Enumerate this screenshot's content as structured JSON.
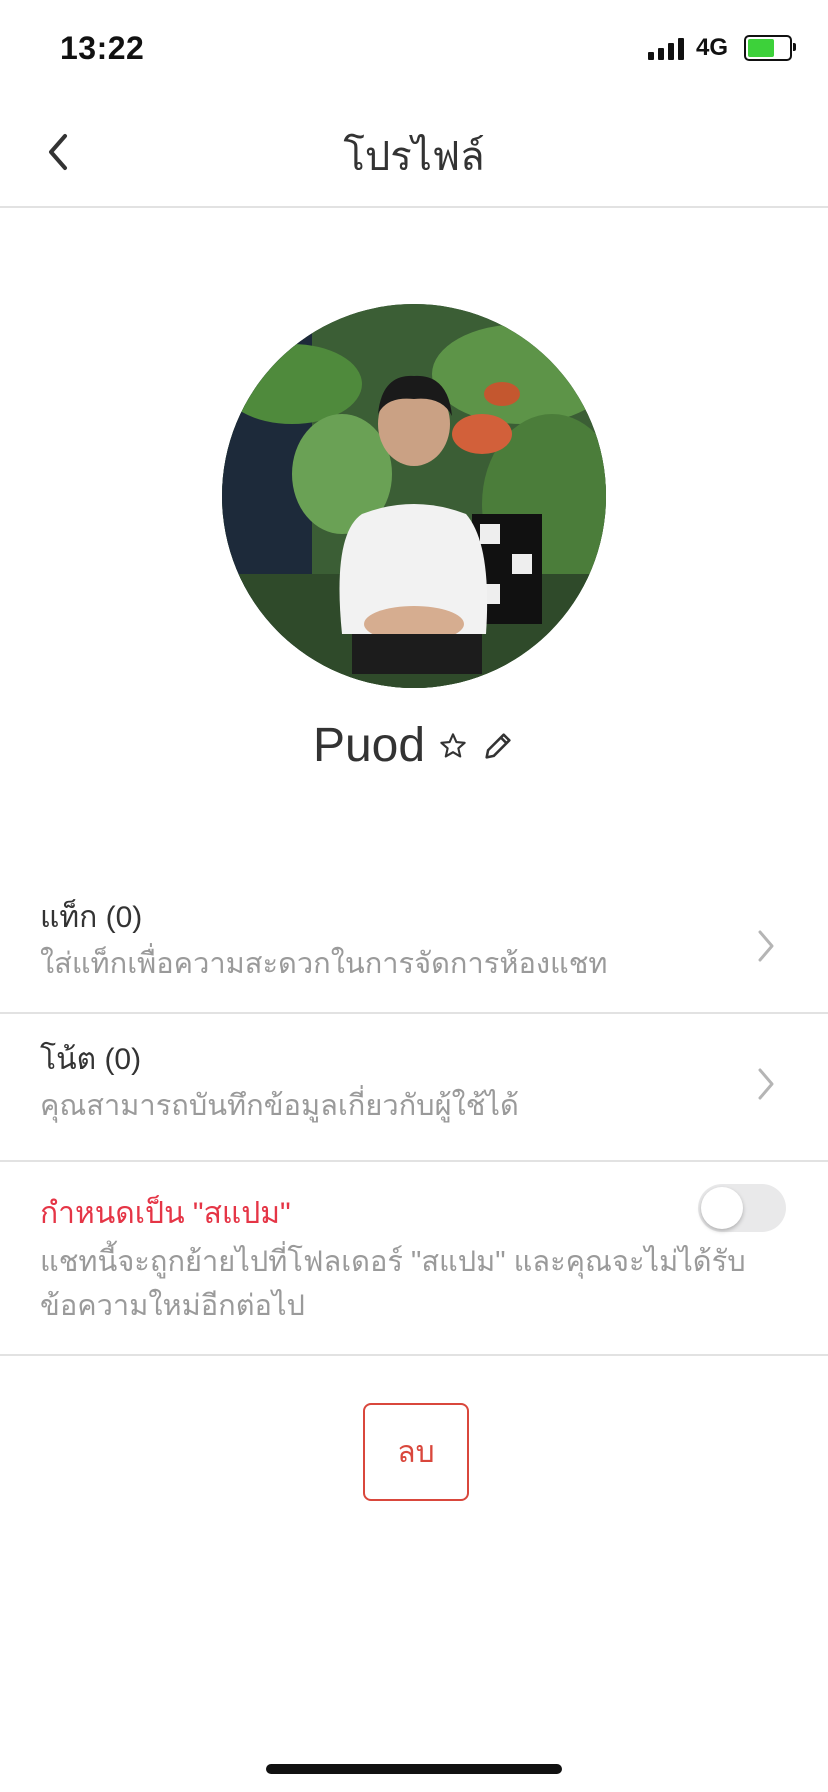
{
  "status_bar": {
    "time": "13:22",
    "network": "4G"
  },
  "header": {
    "title": "โปรไฟล์"
  },
  "profile": {
    "name": "Puod"
  },
  "rows": {
    "tag": {
      "title": "แท็ก (0)",
      "subtitle": "ใส่แท็กเพื่อความสะดวกในการจัดการห้องแชท"
    },
    "note": {
      "title": "โน้ต (0)",
      "subtitle": "คุณสามารถบันทึกข้อมูลเกี่ยวกับผู้ใช้ได้"
    },
    "spam": {
      "title": "กำหนดเป็น \"สแปม\"",
      "subtitle_line1": "แชทนี้จะถูกย้ายไปที่โฟลเดอร์ \"สแปม\" และคุณจะไม่ได้รับ",
      "subtitle_line2": "ข้อความใหม่อีกต่อไป",
      "toggle_on": false
    }
  },
  "actions": {
    "delete_label": "ลบ"
  },
  "colors": {
    "accent_red": "#e53546",
    "delete_red": "#d9473c",
    "divider": "#e2e2e2"
  },
  "icons": [
    "back-chevron-icon",
    "star-icon",
    "pencil-icon",
    "chevron-right-icon"
  ]
}
